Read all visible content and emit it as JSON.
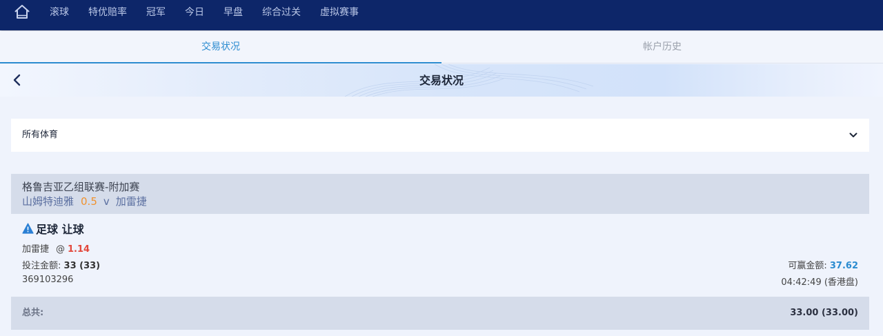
{
  "topnav": {
    "home_icon": "home-icon",
    "items": [
      "滚球",
      "特优赔率",
      "冠军",
      "今日",
      "早盘",
      "综合过关",
      "虚拟赛事"
    ]
  },
  "tabs": [
    {
      "label": "交易状况",
      "active": true
    },
    {
      "label": "帐户历史",
      "active": false
    }
  ],
  "header": {
    "back_icon": "chevron-left-icon",
    "title": "交易状况"
  },
  "filter": {
    "selected": "所有体育",
    "icon": "chevron-down-icon"
  },
  "bet": {
    "league": "格鲁吉亚乙组联赛-附加赛",
    "home_team": "山姆特迪雅",
    "handicap": "0.5",
    "vs": "v",
    "away_team": "加雷捷",
    "warning_icon": "warning-icon",
    "bet_type": "足球 让球",
    "selection": "加雷捷",
    "at_symbol": "@",
    "odds": "1.14",
    "stake_label": "投注金额:",
    "stake_value": "33 (33)",
    "win_label": "可赢金额:",
    "win_value": "37.62",
    "ticket_id": "369103296",
    "time": "04:42:49 (香港盘)"
  },
  "total": {
    "label": "总共:",
    "value": "33.00 (33.00)"
  },
  "colors": {
    "nav_bg": "#0d2669",
    "accent": "#2a8bd0",
    "odds": "#e2483d",
    "handicap": "#f0922e"
  }
}
